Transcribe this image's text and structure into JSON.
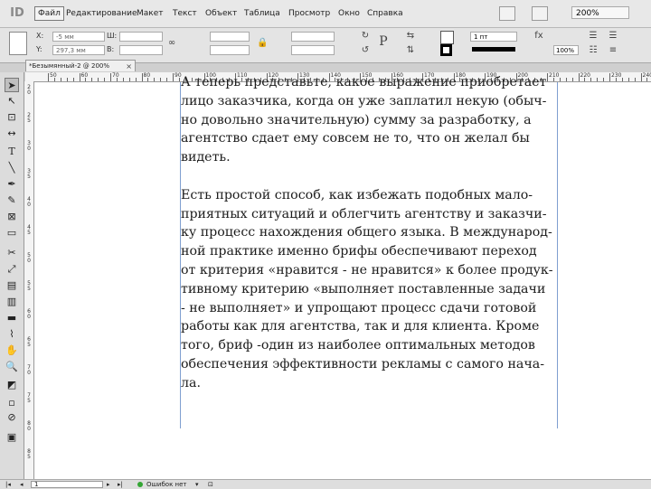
{
  "app": {
    "logo": "ID"
  },
  "menu": {
    "items": [
      "Файл",
      "Редактирование",
      "Макет",
      "Текст",
      "Объект",
      "Таблица",
      "Просмотр",
      "Окно",
      "Справка"
    ],
    "zoom": "200%"
  },
  "control": {
    "x_label": "X:",
    "x_value": "-5 мм",
    "y_label": "Y:",
    "y_value": "297,3 мм",
    "w_label": "Ш:",
    "h_label": "В:",
    "stroke_weight": "1 пт",
    "opacity": "100%",
    "glyph_p": "P"
  },
  "document": {
    "tab_title": "*Безымянный-2 @ 200%",
    "tab_close": "×"
  },
  "ruler": {
    "top_labels": [
      "50",
      "60",
      "70",
      "80",
      "90",
      "100",
      "110",
      "120",
      "130",
      "140",
      "150",
      "160",
      "170",
      "180",
      "190",
      "200",
      "210",
      "220",
      "230",
      "240"
    ],
    "left_labels": [
      "2 0",
      "2 5",
      "3 0",
      "3 5",
      "4 0",
      "4 5",
      "5 0",
      "5 5",
      "6 0",
      "6 5",
      "7 0",
      "7 5",
      "8 0",
      "8 5"
    ]
  },
  "text": {
    "para1": [
      "А теперь представьте, какое выражение приобретает",
      "лицо заказчика, когда он уже заплатил некую (обыч-",
      "но довольно значительную) сумму за разработку, а",
      "агентство сдает ему совсем не то, что он желал бы",
      "видеть."
    ],
    "para2": [
      "Есть простой способ, как избежать подобных мало-",
      "приятных ситуаций и облегчить агентству и заказчи-",
      "ку процесс нахождения общего языка. В международ-",
      "ной практике именно брифы обеспечивают переход",
      "от критерия «нравится - не нравится» к более продук-",
      "тивному критерию «выполняет поставленные задачи",
      "- не выполняет» и упрощают процесс сдачи готовой",
      "работы как для агентства, так и для клиента. Кроме",
      "того, бриф -один из наиболее оптимальных методов",
      "обеспечения эффективности рекламы с самого нача-",
      "ла."
    ]
  },
  "status": {
    "page": "1",
    "errors": "Ошибок нет"
  }
}
